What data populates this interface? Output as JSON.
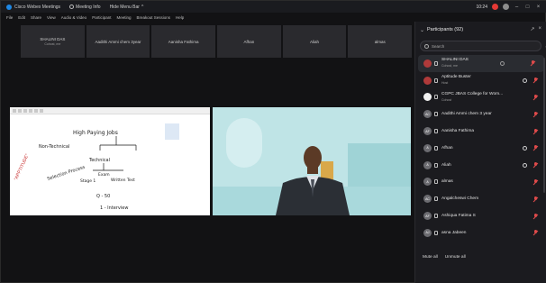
{
  "titlebar": {
    "app_title": "Cisco Webex Meetings",
    "meeting_info": "Meeting Info",
    "hide_menu": "Hide Menu Bar",
    "clock": "10:24"
  },
  "menu": [
    "File",
    "Edit",
    "Share",
    "View",
    "Audio & Video",
    "Participant",
    "Meeting",
    "Breakout Sessions",
    "Help"
  ],
  "filmstrip": [
    {
      "name": "SHALINI DAS",
      "sub": "Cohost, me"
    },
    {
      "name": "Aadithi Ammi chem 3year"
    },
    {
      "name": "Aanisha Fathima"
    },
    {
      "name": "Afhan"
    },
    {
      "name": "Aliah"
    },
    {
      "name": "almas"
    }
  ],
  "participants": {
    "header": "Participants (92)",
    "search_placeholder": "Search",
    "rows": [
      {
        "name": "SHALINI DAS",
        "role": "Cohost, me",
        "avatar": "",
        "active": true
      },
      {
        "name": "Aptitude Buster",
        "role": "Host",
        "avatar": ""
      },
      {
        "name": "CGPC JBAS College for Wom...",
        "role": "Cohost",
        "avatar": ""
      },
      {
        "name": "Aadithi Ammi chem 3 year",
        "avatar": "AC"
      },
      {
        "name": "Aanisha Fathima",
        "avatar": "AF"
      },
      {
        "name": "Afhan",
        "avatar": "A"
      },
      {
        "name": "Aliah",
        "avatar": "A"
      },
      {
        "name": "almas",
        "avatar": "A"
      },
      {
        "name": "Angalcheswi Chem",
        "avatar": "AC"
      },
      {
        "name": "Ashiqua Fatima S",
        "avatar": "AF"
      },
      {
        "name": "asna Jabeen",
        "avatar": "AJ"
      }
    ],
    "mute_all": "Mute all",
    "unmute_all": "Unmute all"
  },
  "whiteboard": {
    "text": [
      "High Paying Jobs",
      "Non-Technical",
      "Technical",
      "Selection Process",
      "Exam",
      "Stage 1",
      "Written Test",
      "\"APPTITUDE\"",
      "Q - 50",
      "1 - Interview"
    ]
  },
  "colors": {
    "accent": "#1e88e5",
    "muted_mic": "#e04b4b",
    "recording": "#e53935",
    "video_bg": "#bfe4e6"
  }
}
